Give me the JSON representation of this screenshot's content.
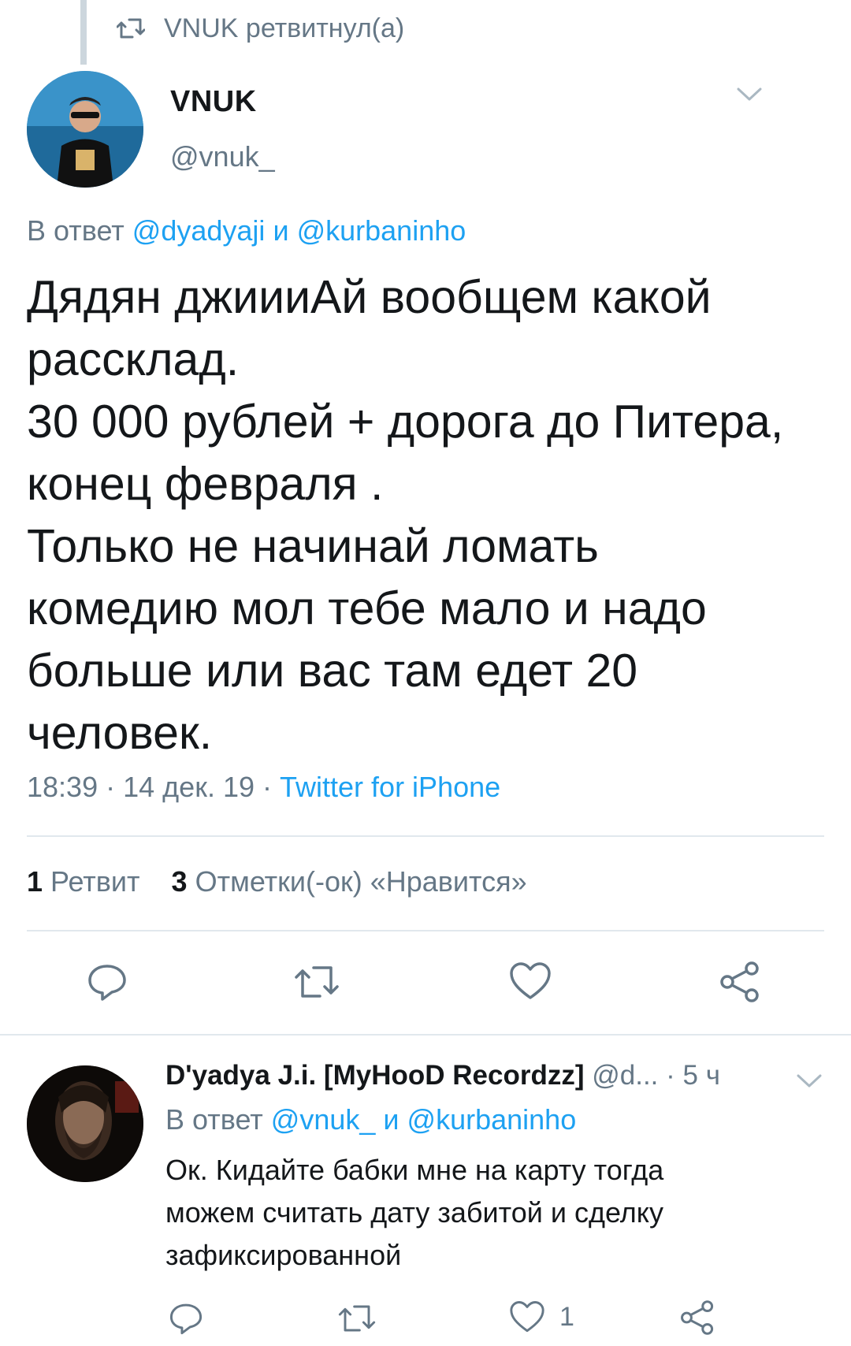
{
  "retweet_context": {
    "icon": "retweet-icon",
    "text": "VNUK ретвитнул(а)"
  },
  "main_tweet": {
    "avatar": "avatar-vnuk",
    "display_name": "VNUK",
    "handle": "@vnuk_",
    "reply_prefix": "В ответ",
    "reply_mention_1": "@dyadyaji",
    "reply_and": "и",
    "reply_mention_2": "@kurbaninho",
    "text_lines": [
      "Дядян джиииАй вообщем какой",
      "рассклад.",
      "30 000 рублей + дорога до Питера,",
      "конец февраля .",
      "Только не начинай ломать",
      "комедию мол тебе мало и надо",
      "больше или вас там едет 20",
      "человек."
    ],
    "time": "18:39",
    "date": "14 дек. 19",
    "separator": "·",
    "source": "Twitter for iPhone",
    "retweet_count": "1",
    "retweet_label": "Ретвит",
    "like_count": "3",
    "like_label": "Отметки(-ок) «Нравится»",
    "actions": [
      "reply-icon",
      "retweet-icon",
      "like-icon",
      "share-icon"
    ]
  },
  "reply_tweet": {
    "avatar": "avatar-dyadya",
    "display_name": "D'yadya J.i. [MyHooD Recordzz]",
    "handle": "@d...",
    "separator": "·",
    "time": "5 ч",
    "reply_prefix": "В ответ",
    "reply_mention_1": "@vnuk_",
    "reply_and": "и",
    "reply_mention_2": "@kurbaninho",
    "text_lines": [
      "Ок. Кидайте бабки мне на карту тогда",
      "можем считать дату забитой и сделку",
      "зафиксированной"
    ],
    "like_count": "1"
  },
  "colors": {
    "accent": "#1da1f2",
    "muted": "#657786",
    "text": "#14171a",
    "divider": "#e1e8ed"
  }
}
